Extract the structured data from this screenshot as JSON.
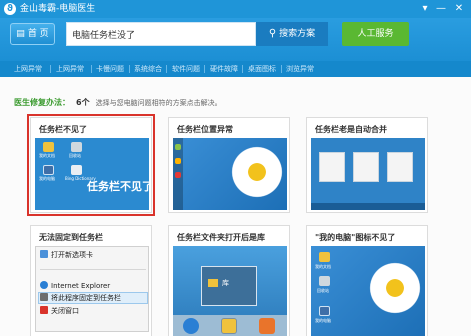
{
  "window": {
    "title": "金山毒霸-电脑医生",
    "controls": [
      "▾",
      "—",
      "✕"
    ]
  },
  "header": {
    "home_label": "首 页",
    "search_value": "电脑任务栏没了",
    "search_button": "搜索方案",
    "human_button": "人工服务"
  },
  "nav": {
    "items": [
      "上网异常",
      "上网异常",
      "卡慢问题",
      "系统综合",
      "软件问题",
      "硬件故障",
      "桌面图标",
      "浏览异常"
    ]
  },
  "method": {
    "label": "医生修复办法：",
    "count": "6个",
    "desc": "选择与您电脑问题相符的方案点击解决。"
  },
  "cards": [
    {
      "title": "任务栏不见了",
      "caption": "任务栏不见了",
      "icons": [
        "我的文档",
        "回收站",
        "我的电脑",
        "Bing Dictionary"
      ]
    },
    {
      "title": "任务栏位置异常"
    },
    {
      "title": "任务栏老是自动合并"
    },
    {
      "title": "无法固定到任务栏",
      "menu": [
        "打开新选项卡",
        "Internet Explorer",
        "将此程序固定到任务栏",
        "关闭窗口"
      ]
    },
    {
      "title": "任务栏文件夹打开后是库",
      "popup": "库"
    },
    {
      "title": "\"我的电脑\"图标不见了",
      "icons": [
        "我的文档",
        "回收站",
        "我的电脑"
      ]
    }
  ],
  "colors": {
    "titlebar": "#1f95d8",
    "header": "#2a9de0",
    "nav": "#1588cc",
    "human_button": "#5ab832",
    "method_label": "#3a9a2e",
    "selection": "#d9332b"
  }
}
